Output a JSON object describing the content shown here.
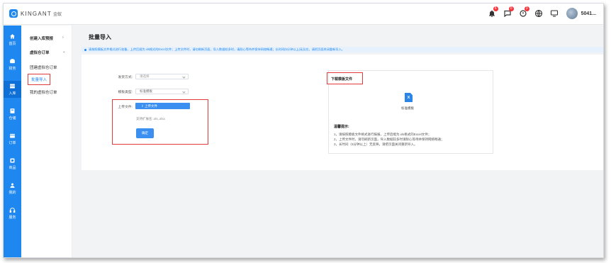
{
  "app": {
    "logo_text": "KINGANT",
    "logo_cn": "金蚁",
    "username": "5041..."
  },
  "header_icons": [
    {
      "name": "bell-icon",
      "badge": "6"
    },
    {
      "name": "message-icon",
      "badge": "0"
    },
    {
      "name": "order-alert-icon",
      "badge": "3"
    },
    {
      "name": "globe-icon",
      "badge": ""
    },
    {
      "name": "screen-icon",
      "badge": ""
    }
  ],
  "nav": {
    "items": [
      {
        "label": "首页",
        "icon": "home-icon"
      },
      {
        "label": "财务",
        "icon": "finance-icon"
      },
      {
        "label": "入库",
        "icon": "inbound-icon",
        "active": true
      },
      {
        "label": "仓储",
        "icon": "warehouse-icon"
      },
      {
        "label": "订单",
        "icon": "order-icon"
      },
      {
        "label": "商品",
        "icon": "product-icon"
      },
      {
        "label": "我的",
        "icon": "user-icon"
      },
      {
        "label": "服务",
        "icon": "headset-icon"
      }
    ]
  },
  "submenu": {
    "group1": "创建入库预报",
    "group1_chev": "›",
    "group2": "虚拟仓订单",
    "group2_chev": "⌄",
    "item1": "团建虚拟仓订单",
    "item2": "批量导入",
    "item3": "我的虚拟仓订单"
  },
  "page": {
    "title": "批量导入",
    "notice": "请按照模板文件格式进行准备，上传后缀为.xls格式的Excel文件；上传文件时，请勿刷新页面，导入数据较多时，请耐心等待并保持网络畅通；长时间(5分钟以上)无反应，请把页面关闭重新导入。"
  },
  "form": {
    "ship_label": "发货方式:",
    "ship_placeholder": "请选择",
    "tpl_label": "模板类型:",
    "tpl_value": "标准模板",
    "upload_label": "上传文件:",
    "upload_btn": "⇪ 上传文件",
    "upload_hint": "支持扩展名:.xls,.xlsx",
    "confirm_btn": "确定"
  },
  "template_panel": {
    "title": "下载模板文件",
    "file_label": "标准模板",
    "file_icon_letter": "X",
    "tips_title": "温馨提示:",
    "tips": [
      "1，请按照模板文件格式进行报报，上传后缀为.xls格式的Excel文件；",
      "2，上传文件时，请勿刷新页面，导入数据较多时请耐心等待并保持网络畅通；",
      "3，长时间（5分钟以上）无反映，请把页面关闭重新导入。"
    ]
  },
  "colors": {
    "accent": "#1f87f0",
    "highlight_border": "#e03a3a",
    "badge": "#f5333b"
  }
}
